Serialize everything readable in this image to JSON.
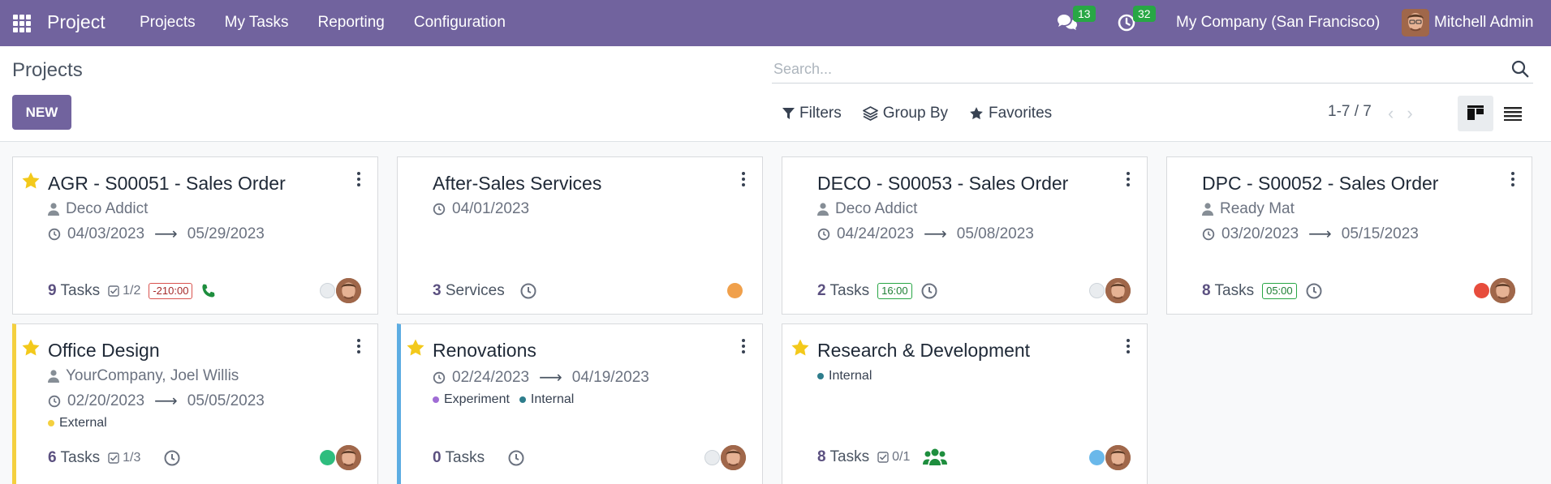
{
  "navbar": {
    "brand": "Project",
    "menu": [
      "Projects",
      "My Tasks",
      "Reporting",
      "Configuration"
    ],
    "messages_count": "13",
    "activities_count": "32",
    "company": "My Company (San Francisco)",
    "user": "Mitchell Admin"
  },
  "control": {
    "breadcrumb": "Projects",
    "new_label": "NEW",
    "search_placeholder": "Search...",
    "filters_label": "Filters",
    "groupby_label": "Group By",
    "favorites_label": "Favorites",
    "pager": "1-7 / 7"
  },
  "colors": {
    "brand": "#71639e",
    "badge": "#28a745",
    "star": "#f3c91b"
  },
  "cards": [
    {
      "title": "AGR - S00051 - Sales Order",
      "favorite": true,
      "customer": "Deco Addict",
      "date_start": "04/03/2023",
      "date_end": "05/29/2023",
      "count": "9",
      "count_label": "Tasks",
      "milestone": "1/2",
      "time": "-210:00",
      "status_color": "#e9ecef",
      "avatar": true
    },
    {
      "title": "After-Sales Services",
      "favorite": false,
      "date_single": "04/01/2023",
      "count": "3",
      "count_label": "Services",
      "status_color": "#f0a04b",
      "avatar": false
    },
    {
      "title": "DECO - S00053 - Sales Order",
      "favorite": false,
      "customer": "Deco Addict",
      "date_start": "04/24/2023",
      "date_end": "05/08/2023",
      "count": "2",
      "count_label": "Tasks",
      "time": "16:00",
      "status_color": "#e9ecef",
      "avatar": true
    },
    {
      "title": "DPC - S00052 - Sales Order",
      "favorite": false,
      "customer": "Ready Mat",
      "date_start": "03/20/2023",
      "date_end": "05/15/2023",
      "count": "8",
      "count_label": "Tasks",
      "time": "05:00",
      "status_color": "#e74c3c",
      "avatar": true
    },
    {
      "title": "Office Design",
      "favorite": true,
      "customer": "YourCompany, Joel Willis",
      "date_start": "02/20/2023",
      "date_end": "05/05/2023",
      "tags": [
        {
          "label": "External",
          "color": "#f4d03f"
        }
      ],
      "count": "6",
      "count_label": "Tasks",
      "milestone": "1/3",
      "status_color": "#2ebd7e",
      "avatar": true
    },
    {
      "title": "Renovations",
      "favorite": true,
      "date_start": "02/24/2023",
      "date_end": "04/19/2023",
      "tags": [
        {
          "label": "Experiment",
          "color": "#a06cd5"
        },
        {
          "label": "Internal",
          "color": "#2e7d8c"
        }
      ],
      "count": "0",
      "count_label": "Tasks",
      "status_color": "#e9ecef",
      "avatar": true
    },
    {
      "title": "Research & Development",
      "favorite": true,
      "tags": [
        {
          "label": "Internal",
          "color": "#2e7d8c"
        }
      ],
      "count": "8",
      "count_label": "Tasks",
      "milestone": "0/1",
      "status_color": "#6ab8ea",
      "avatar": true
    }
  ]
}
